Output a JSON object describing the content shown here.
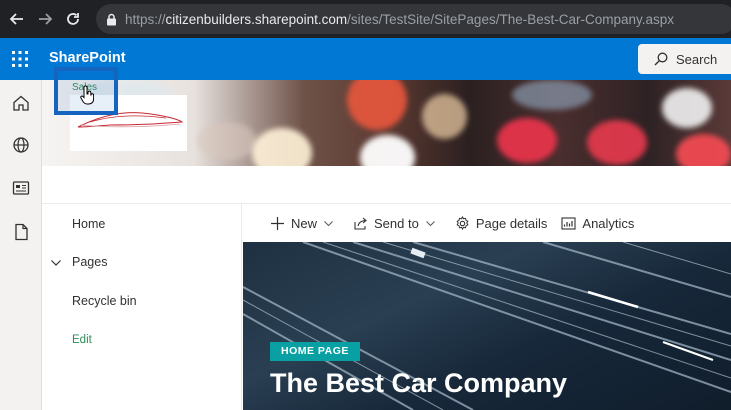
{
  "browser": {
    "url_scheme": "https://",
    "url_host": "citizenbuilders.sharepoint.com",
    "url_path": "/sites/TestSite/SitePages/The-Best-Car-Company.aspx",
    "icons": [
      "back-arrow-icon",
      "forward-arrow-icon",
      "reload-icon",
      "lock-icon"
    ]
  },
  "suite": {
    "app_name": "SharePoint",
    "search_label": "Search",
    "accent_color": "#0078d4"
  },
  "app_rail": {
    "icons": [
      "home-icon",
      "globe-icon",
      "news-icon",
      "document-icon"
    ]
  },
  "header": {
    "site_title": "Sales"
  },
  "left_nav": {
    "items": [
      {
        "label": "Home"
      },
      {
        "label": "Pages",
        "expandable": true
      },
      {
        "label": "Recycle bin"
      }
    ],
    "edit_label": "Edit"
  },
  "command_bar": {
    "new_label": "New",
    "send_to_label": "Send to",
    "page_details_label": "Page details",
    "analytics_label": "Analytics"
  },
  "hero": {
    "badge": "HOME PAGE",
    "badge_color": "#08a0a3",
    "title": "The Best Car Company"
  }
}
